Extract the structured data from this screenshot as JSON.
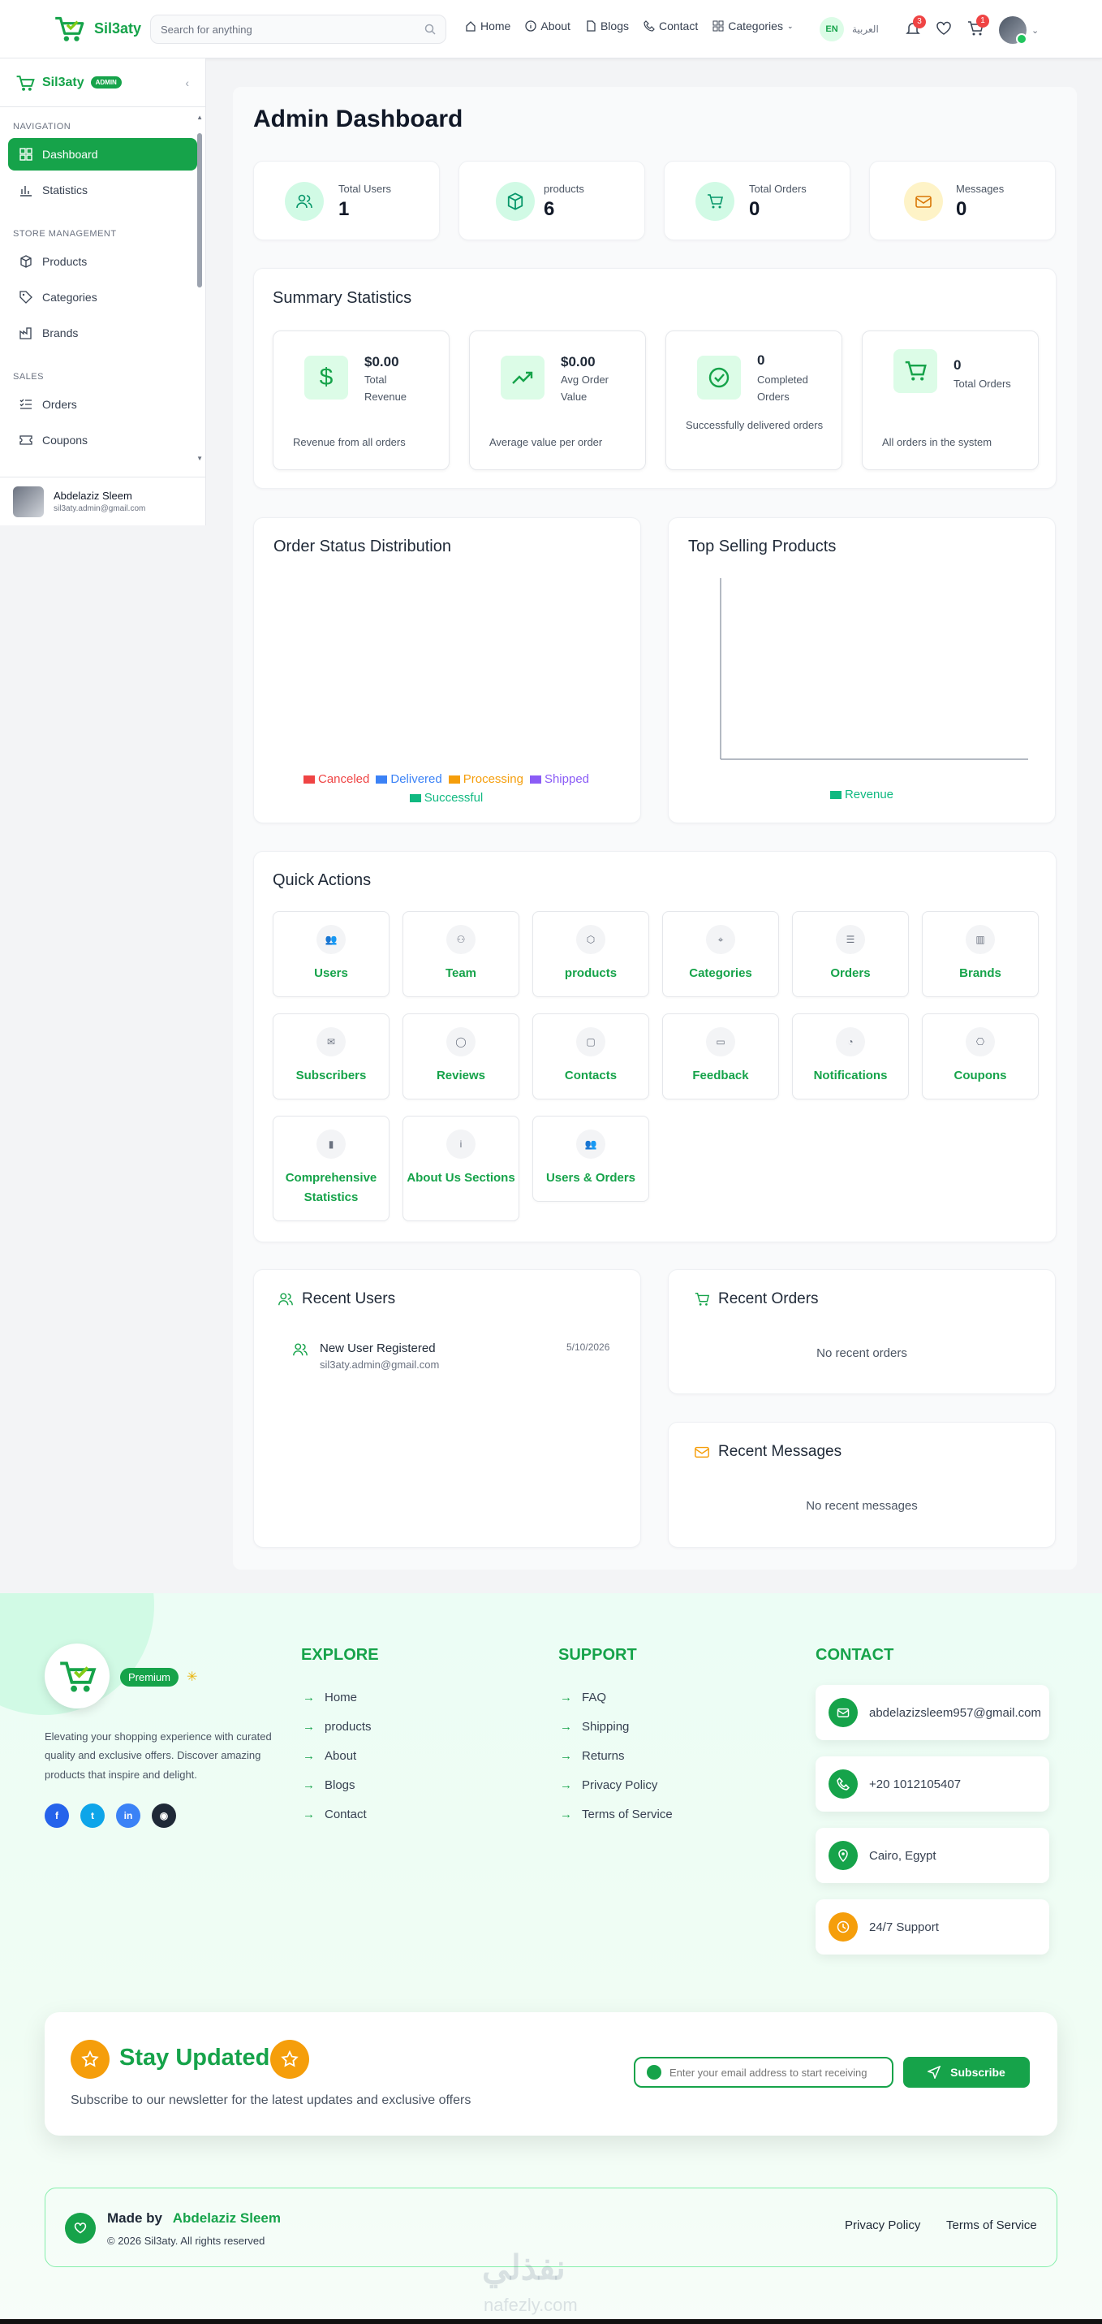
{
  "topbar": {
    "brand": "Sil3aty",
    "search_placeholder": "Search for anything",
    "nav": [
      "Home",
      "About",
      "Blogs",
      "Contact",
      "Categories"
    ],
    "lang_en": "EN",
    "lang_ar": "العربية",
    "notif_count": "3",
    "cart_count": "1"
  },
  "sidebar": {
    "brand": "Sil3aty",
    "badge": "ADMIN",
    "sections": {
      "navigation": "NAVIGATION",
      "store": "STORE MANAGEMENT",
      "sales": "SALES"
    },
    "items": {
      "dashboard": "Dashboard",
      "statistics": "Statistics",
      "products": "Products",
      "categories": "Categories",
      "brands": "Brands",
      "orders": "Orders",
      "coupons": "Coupons"
    },
    "user_name": "Abdelaziz Sleem",
    "user_email": "sil3aty.admin@gmail.com"
  },
  "dashboard": {
    "title": "Admin Dashboard",
    "stats": [
      {
        "label": "Total Users",
        "value": "1"
      },
      {
        "label": "products",
        "value": "6"
      },
      {
        "label": "Total Orders",
        "value": "0"
      },
      {
        "label": "Messages",
        "value": "0"
      }
    ],
    "summary_title": "Summary Statistics",
    "summary": [
      {
        "value": "$0.00",
        "label": "Total Revenue",
        "desc": "Revenue from all orders"
      },
      {
        "value": "$0.00",
        "label": "Avg Order Value",
        "desc": "Average value per order"
      },
      {
        "value": "0",
        "label": "Completed Orders",
        "desc": "Successfully delivered orders"
      },
      {
        "value": "0",
        "label": "Total Orders",
        "desc": "All orders in the system"
      }
    ],
    "order_status_title": "Order Status Distribution",
    "top_selling_title": "Top Selling Products",
    "quick_actions_title": "Quick Actions",
    "quick_actions": [
      "Users",
      "Team",
      "products",
      "Categories",
      "Orders",
      "Brands",
      "Subscribers",
      "Reviews",
      "Contacts",
      "Feedback",
      "Notifications",
      "Coupons",
      "Comprehensive Statistics",
      "About Us Sections",
      "Users & Orders"
    ],
    "recent_users_title": "Recent Users",
    "recent_user": {
      "title": "New User Registered",
      "email": "sil3aty.admin@gmail.com",
      "date": "5/10/2026"
    },
    "recent_orders_title": "Recent Orders",
    "recent_orders_empty": "No recent orders",
    "recent_messages_title": "Recent Messages",
    "recent_messages_empty": "No recent messages"
  },
  "chart_data": [
    {
      "type": "pie",
      "title": "Order Status Distribution",
      "categories": [
        "Canceled",
        "Delivered",
        "Processing",
        "Shipped",
        "Successful"
      ],
      "values": [
        0,
        0,
        0,
        0,
        0
      ],
      "colors": [
        "#ef4444",
        "#3b82f6",
        "#f59e0b",
        "#8b5cf6",
        "#10b981"
      ],
      "legend": "bottom"
    },
    {
      "type": "bar",
      "title": "Top Selling Products",
      "categories": [],
      "series": [
        {
          "name": "Revenue",
          "values": []
        }
      ],
      "colors": [
        "#10b981"
      ],
      "legend": "bottom"
    }
  ],
  "footer": {
    "premium": "Premium",
    "description": "Elevating your shopping experience with curated quality and exclusive offers. Discover amazing products that inspire and delight.",
    "explore_title": "EXPLORE",
    "explore": [
      "Home",
      "products",
      "About",
      "Blogs",
      "Contact"
    ],
    "support_title": "SUPPORT",
    "support": [
      "FAQ",
      "Shipping",
      "Returns",
      "Privacy Policy",
      "Terms of Service"
    ],
    "contact_title": "CONTACT",
    "contact": [
      "abdelazizsleem957@gmail.com",
      "+20 1012105407",
      "Cairo, Egypt",
      "24/7 Support"
    ],
    "newsletter_title": "Stay Updated",
    "newsletter_text": "Subscribe to our newsletter for the latest updates and exclusive offers",
    "newsletter_placeholder": "Enter your email address to start receiving",
    "subscribe": "Subscribe",
    "made_by": "Made by",
    "author": "Abdelaziz Sleem",
    "copyright": "© 2026 Sil3aty. All rights reserved",
    "privacy": "Privacy Policy",
    "terms": "Terms of Service",
    "watermark": "nafezly.com",
    "watermark_ar": "نفذلي"
  },
  "colors": {
    "accent": "#16a34a",
    "accent_light": "#dcfce7",
    "orange": "#f59e0b"
  }
}
